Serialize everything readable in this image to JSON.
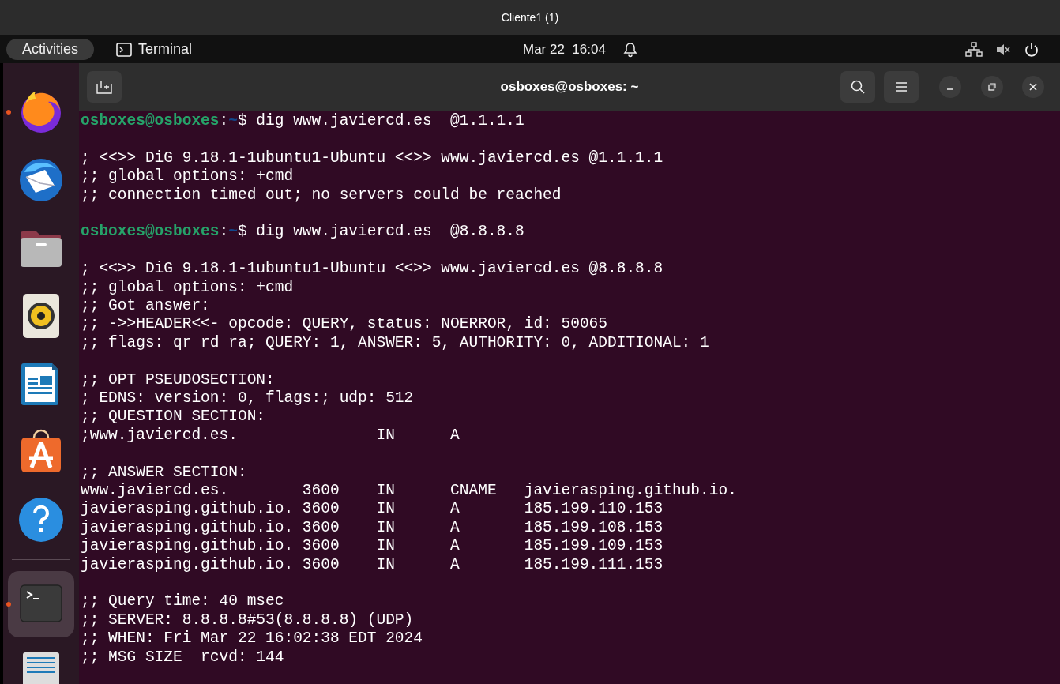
{
  "window": {
    "title": "Cliente1 (1)"
  },
  "top_bar": {
    "activities": "Activities",
    "app_name": "Terminal",
    "clock": "Mar 22  16:04"
  },
  "dock": {
    "items": [
      {
        "kind": "browser",
        "running": true,
        "focused": false
      },
      {
        "kind": "mail",
        "running": false,
        "focused": false
      },
      {
        "kind": "files",
        "running": false,
        "focused": false
      },
      {
        "kind": "music",
        "running": false,
        "focused": false
      },
      {
        "kind": "writer",
        "running": false,
        "focused": false
      },
      {
        "kind": "store",
        "running": false,
        "focused": false
      },
      {
        "kind": "help",
        "running": false,
        "focused": false
      },
      {
        "kind": "terminal",
        "running": true,
        "focused": true
      },
      {
        "kind": "editor",
        "running": false,
        "focused": false
      }
    ]
  },
  "terminal": {
    "title": "osboxes@osboxes: ~",
    "blocks": [
      [
        {
          "kind": "prompt",
          "user_host": "osboxes@osboxes",
          "separator": ":",
          "path": "~",
          "symbol": "$",
          "command": "dig www.javiercd.es  @1.1.1.1"
        }
      ],
      [
        {
          "kind": "output",
          "text": "; <<>> DiG 9.18.1-1ubuntu1-Ubuntu <<>> www.javiercd.es @1.1.1.1"
        },
        {
          "kind": "output",
          "text": ";; global options: +cmd"
        },
        {
          "kind": "output",
          "text": ";; connection timed out; no servers could be reached"
        }
      ],
      [
        {
          "kind": "prompt",
          "user_host": "osboxes@osboxes",
          "separator": ":",
          "path": "~",
          "symbol": "$",
          "command": "dig www.javiercd.es  @8.8.8.8"
        }
      ],
      [
        {
          "kind": "output",
          "text": "; <<>> DiG 9.18.1-1ubuntu1-Ubuntu <<>> www.javiercd.es @8.8.8.8"
        },
        {
          "kind": "output",
          "text": ";; global options: +cmd"
        },
        {
          "kind": "output",
          "text": ";; Got answer:"
        },
        {
          "kind": "output",
          "text": ";; ->>HEADER<<- opcode: QUERY, status: NOERROR, id: 50065"
        },
        {
          "kind": "output",
          "text": ";; flags: qr rd ra; QUERY: 1, ANSWER: 5, AUTHORITY: 0, ADDITIONAL: 1"
        }
      ],
      [
        {
          "kind": "output",
          "text": ";; OPT PSEUDOSECTION:"
        },
        {
          "kind": "output",
          "text": "; EDNS: version: 0, flags:; udp: 512"
        },
        {
          "kind": "output",
          "text": ";; QUESTION SECTION:"
        },
        {
          "kind": "output",
          "text": ";www.javiercd.es.               IN      A"
        }
      ],
      [
        {
          "kind": "output",
          "text": ";; ANSWER SECTION:"
        },
        {
          "kind": "output",
          "text": "www.javiercd.es.        3600    IN      CNAME   javierasping.github.io."
        },
        {
          "kind": "output",
          "text": "javierasping.github.io. 3600    IN      A       185.199.110.153"
        },
        {
          "kind": "output",
          "text": "javierasping.github.io. 3600    IN      A       185.199.108.153"
        },
        {
          "kind": "output",
          "text": "javierasping.github.io. 3600    IN      A       185.199.109.153"
        },
        {
          "kind": "output",
          "text": "javierasping.github.io. 3600    IN      A       185.199.111.153"
        }
      ],
      [
        {
          "kind": "output",
          "text": ";; Query time: 40 msec"
        },
        {
          "kind": "output",
          "text": ";; SERVER: 8.8.8.8#53(8.8.8.8) (UDP)"
        },
        {
          "kind": "output",
          "text": ";; WHEN: Fri Mar 22 16:02:38 EDT 2024"
        },
        {
          "kind": "output",
          "text": ";; MSG SIZE  rcvd: 144"
        }
      ]
    ]
  }
}
